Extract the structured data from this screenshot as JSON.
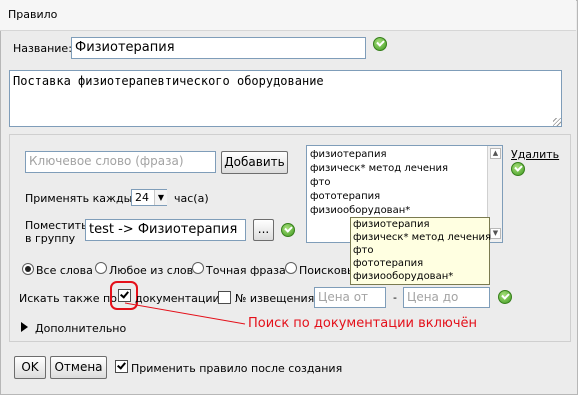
{
  "dialog": {
    "title": "Правило"
  },
  "name_field": {
    "label": "Название:",
    "value": "Физиотерапия"
  },
  "description": {
    "value": "Поставка физиотерапевтического оборудование"
  },
  "keyword": {
    "placeholder": "Ключевое слово (фраза)",
    "add_label": "Добавить",
    "delete_label": "Удалить"
  },
  "keywords_list": {
    "items": [
      "физиотерапия",
      "физическ* метод лечения",
      "фто",
      "фототерапия",
      "физиооборудован*"
    ]
  },
  "tooltip": {
    "items": [
      "физиотерапия",
      "физическ* метод лечения",
      "фто",
      "фототерапия",
      "физиооборудован*"
    ]
  },
  "apply_every": {
    "label": "Применять каждые",
    "value": "24",
    "unit": "час(а)"
  },
  "group": {
    "label_line1": "Поместить",
    "label_line2": "в группу",
    "value": "test -> Физиотерапия",
    "browse_label": "..."
  },
  "match_modes": {
    "all_words": "Все слова",
    "any_words": "Любое из слов",
    "exact_phrase": "Точная фраза",
    "search": "Поисковы"
  },
  "search_also": {
    "label": "Искать также по:",
    "documentation": "документации",
    "notice_no": "№ извещения",
    "price_from": "Цена от",
    "dash": "-",
    "price_to": "Цена до"
  },
  "annotation": {
    "text": "Поиск по документации включён",
    "color": "#e4101a"
  },
  "advanced": {
    "label": "Дополнительно"
  },
  "footer": {
    "ok_label": "OK",
    "cancel_label": "Отмена",
    "apply_label": "Применить правило после создания"
  }
}
